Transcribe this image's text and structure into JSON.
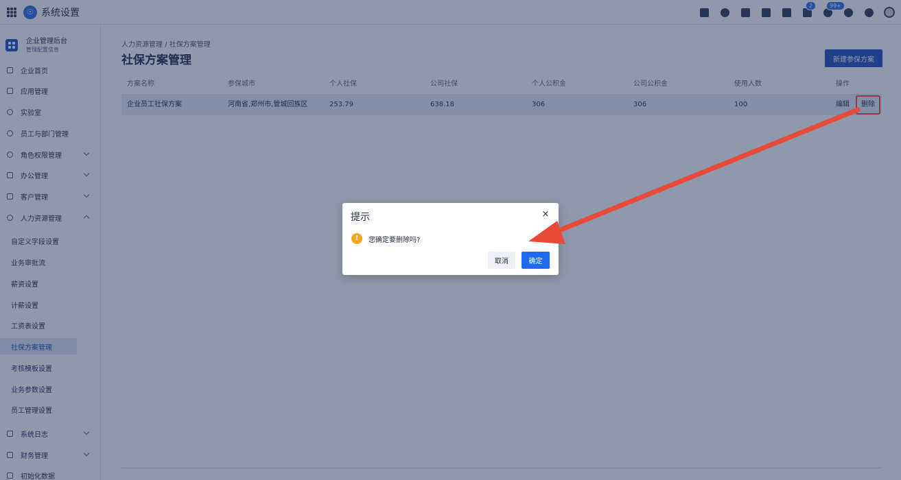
{
  "header": {
    "app_title": "系统设置",
    "tools": [
      {
        "icon": "calendar-check-icon"
      },
      {
        "icon": "user-icon"
      },
      {
        "icon": "document-icon"
      },
      {
        "icon": "phone-icon"
      },
      {
        "icon": "calendar-icon"
      },
      {
        "icon": "flag-icon",
        "badge": "2"
      },
      {
        "icon": "bell-icon",
        "badge": "99+"
      },
      {
        "icon": "help-icon"
      },
      {
        "icon": "gear-icon"
      },
      {
        "icon": "avatar-icon"
      }
    ]
  },
  "sidebar": {
    "org_name": "企业管理后台",
    "org_sub": "管理配置信息",
    "items": [
      {
        "label": "企业首页",
        "icon": "home-icon"
      },
      {
        "label": "应用管理",
        "icon": "apps-icon"
      },
      {
        "label": "实验室",
        "icon": "bulb-icon"
      },
      {
        "label": "员工与部门管理",
        "icon": "team-icon"
      },
      {
        "label": "角色权限管理",
        "icon": "role-icon"
      },
      {
        "label": "办公管理",
        "icon": "office-icon"
      },
      {
        "label": "客户管理",
        "icon": "customer-icon"
      },
      {
        "label": "人力资源管理",
        "icon": "hr-icon"
      }
    ],
    "sub_items": [
      "自定义字段设置",
      "业务审批流",
      "薪资设置",
      "计薪设置",
      "工资表设置",
      "社保方案管理",
      "考核模板设置",
      "业务参数设置",
      "员工管理设置"
    ],
    "items_after": [
      {
        "label": "系统日志",
        "icon": "log-icon"
      },
      {
        "label": "财务管理",
        "icon": "finance-icon"
      },
      {
        "label": "初始化数据",
        "icon": "init-icon"
      }
    ]
  },
  "main": {
    "breadcrumb": "人力资源管理 / 社保方案管理",
    "title": "社保方案管理",
    "new_button": "新建参保方案",
    "columns": [
      "方案名称",
      "参保城市",
      "个人社保",
      "公司社保",
      "个人公积金",
      "公司公积金",
      "使用人数",
      "操作"
    ],
    "rows": [
      {
        "name": "企业员工社保方案",
        "city": "河南省,郑州市,管城回族区",
        "personal_social": "253.79",
        "company_social": "638.18",
        "personal_fund": "306",
        "company_fund": "306",
        "users": "100",
        "edit": "编辑",
        "delete": "删除"
      }
    ]
  },
  "dialog": {
    "title": "提示",
    "close": "×",
    "warn_icon": "!",
    "message": "您确定要删除吗?",
    "cancel": "取消",
    "confirm": "确定"
  },
  "colors": {
    "primary": "#1f4fb8",
    "confirm": "#1f6bf0",
    "annotation": "#e84a3a",
    "warning": "#f5a623"
  }
}
